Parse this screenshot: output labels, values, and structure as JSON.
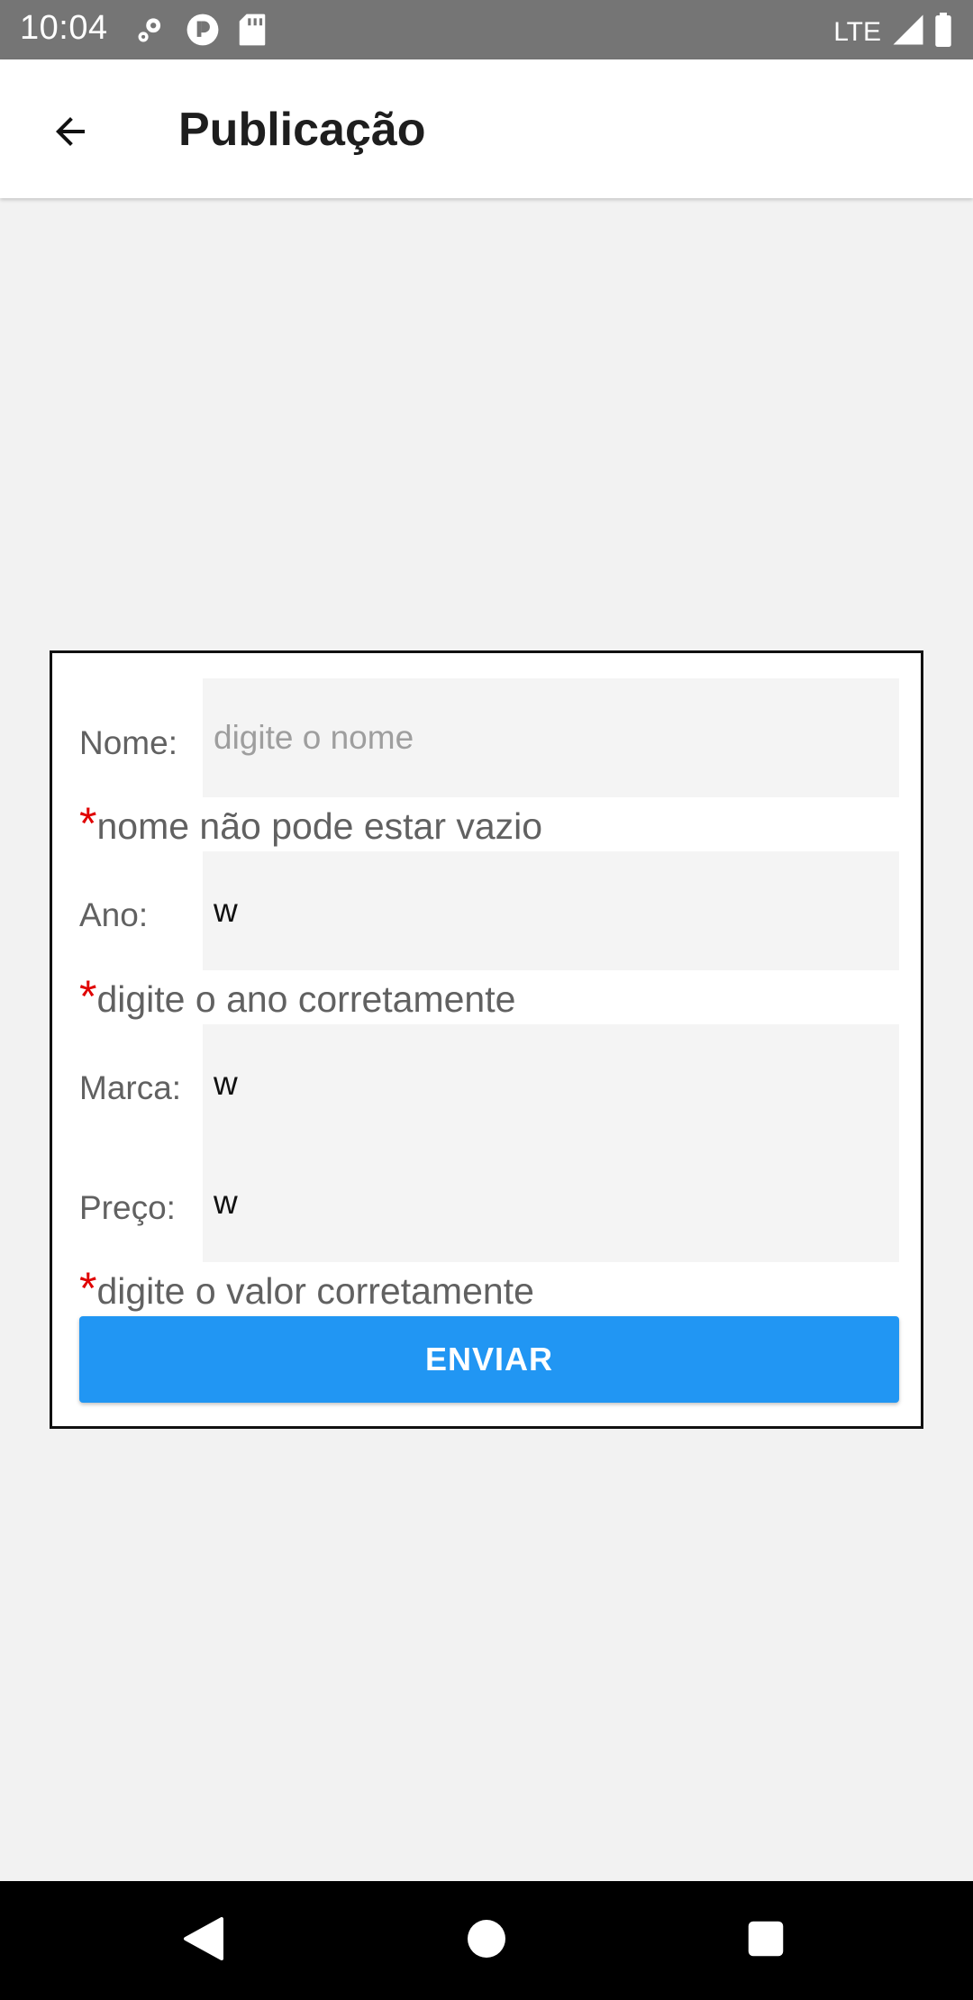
{
  "status_bar": {
    "time": "10:04",
    "network": "LTE",
    "icons": [
      "settings-icon",
      "privacy-icon",
      "sd-card-icon",
      "signal-icon",
      "battery-icon"
    ]
  },
  "app_bar": {
    "title": "Publicação",
    "back_icon": "arrow-back-icon"
  },
  "form": {
    "name": {
      "label": "Nome:",
      "value": "",
      "placeholder": "digite o nome",
      "error": "nome não pode estar vazio"
    },
    "year": {
      "label": "Ano:",
      "value": "w",
      "error": "digite o ano corretamente"
    },
    "brand": {
      "label": "Marca:",
      "value": "w"
    },
    "price": {
      "label": "Preço:",
      "value": "w",
      "error": "digite o valor corretamente"
    },
    "error_marker": "*",
    "submit_label": "ENVIAR"
  },
  "nav_bar": {
    "icons": [
      "back-triangle-icon",
      "home-circle-icon",
      "recents-square-icon"
    ]
  },
  "colors": {
    "status_bar": "#757575",
    "accent": "#2196f3",
    "error_marker": "#e00000",
    "background": "#f2f2f2"
  }
}
